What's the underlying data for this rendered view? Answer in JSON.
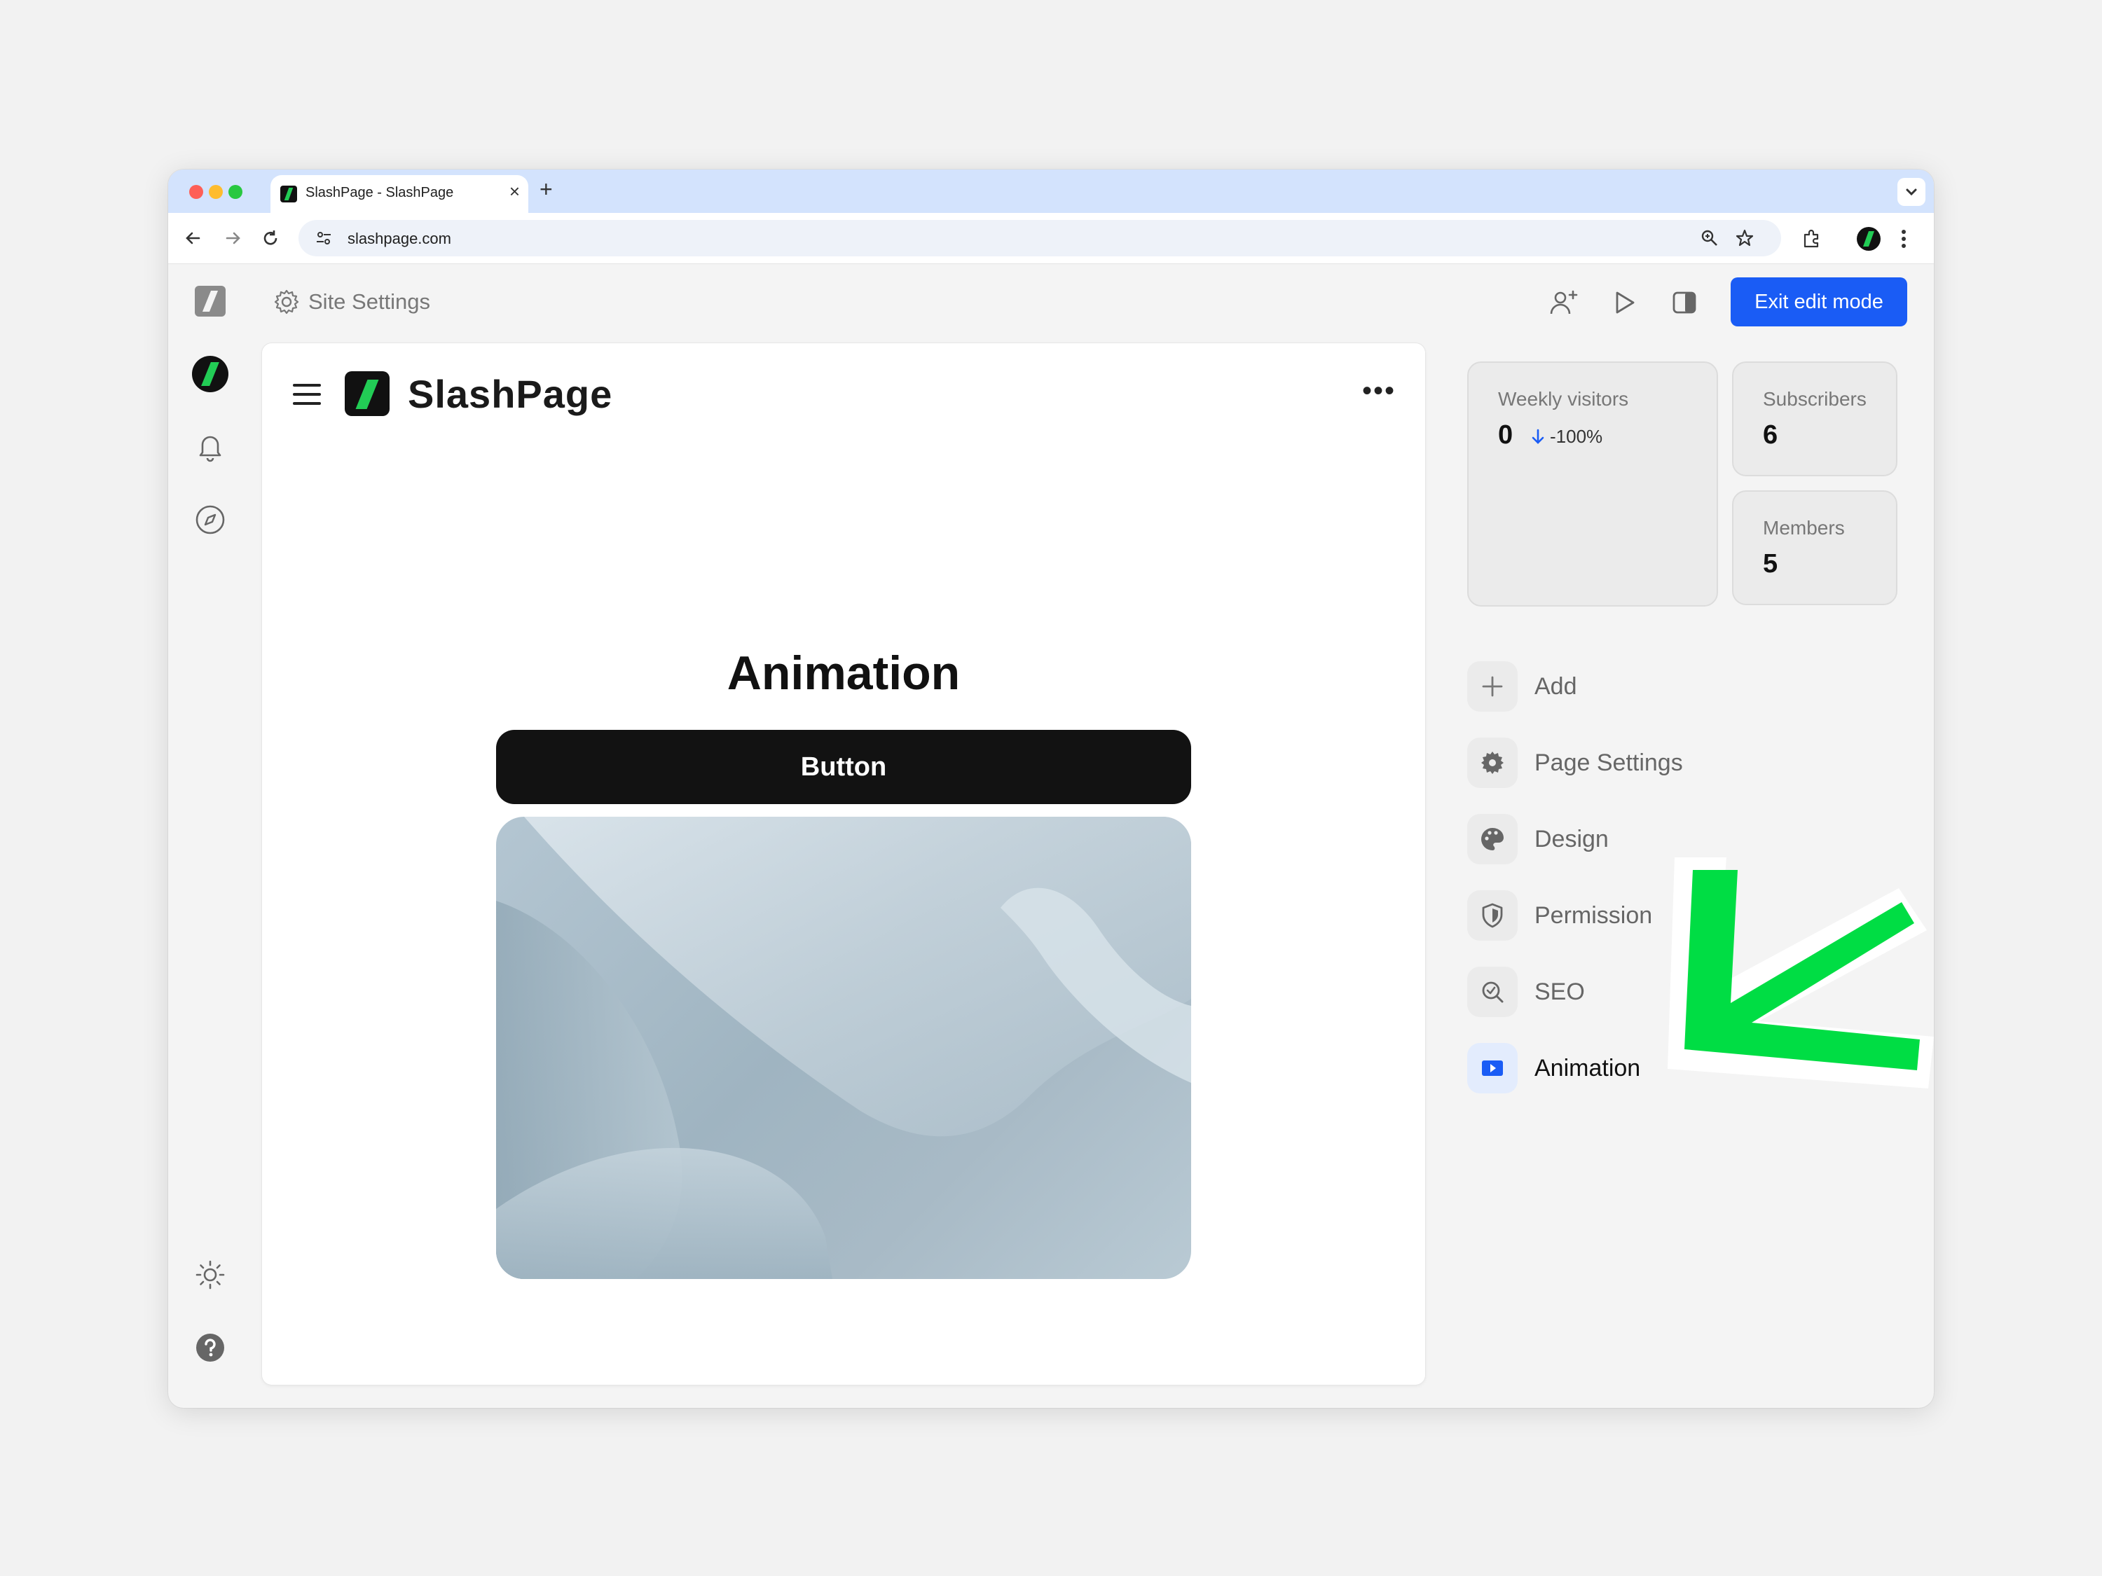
{
  "browser": {
    "tab_title": "SlashPage - SlashPage",
    "tab_close": "×",
    "new_tab": "+",
    "url": "slashpage.com"
  },
  "topbar": {
    "site_settings_label": "Site Settings",
    "exit_edit_label": "Exit edit mode"
  },
  "canvas": {
    "brand_name": "SlashPage",
    "more_label": "•••",
    "heading": "Animation",
    "button_label": "Button"
  },
  "stats": {
    "weekly_visitors": {
      "label": "Weekly visitors",
      "value": "0",
      "trend": "-100%"
    },
    "subscribers": {
      "label": "Subscribers",
      "value": "6"
    },
    "members": {
      "label": "Members",
      "value": "5"
    }
  },
  "menu": {
    "items": [
      {
        "label": "Add",
        "icon": "plus-icon"
      },
      {
        "label": "Page Settings",
        "icon": "gear-icon"
      },
      {
        "label": "Design",
        "icon": "palette-icon"
      },
      {
        "label": "Permission",
        "icon": "shield-icon"
      },
      {
        "label": "SEO",
        "icon": "search-check-icon"
      },
      {
        "label": "Animation",
        "icon": "play-icon",
        "active": true
      }
    ]
  },
  "colors": {
    "accent_blue": "#1a5cf5",
    "brand_green": "#22cc55",
    "annotation_arrow": "#00dd44"
  }
}
